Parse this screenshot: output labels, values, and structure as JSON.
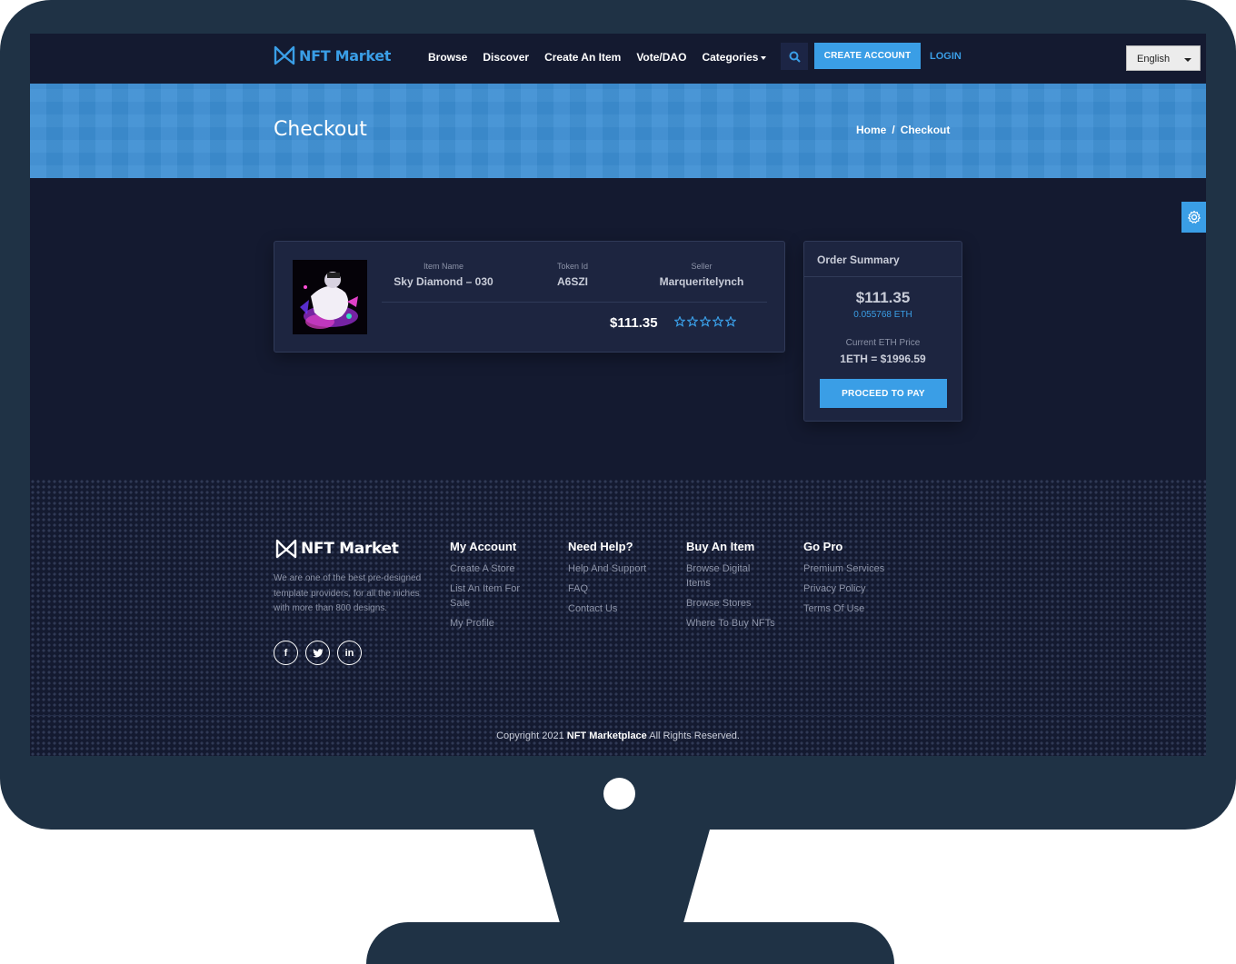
{
  "header": {
    "logo_text": "NFT Market",
    "nav": [
      "Browse",
      "Discover",
      "Create An Item",
      "Vote/DAO",
      "Categories"
    ],
    "create_account": "CREATE ACCOUNT",
    "login": "LOGIN",
    "language": "English"
  },
  "banner": {
    "title": "Checkout",
    "breadcrumb_home": "Home",
    "breadcrumb_sep": "/",
    "breadcrumb_current": "Checkout"
  },
  "item": {
    "name_label": "Item Name",
    "name": "Sky Diamond – 030",
    "token_label": "Token Id",
    "token": "A6SZI",
    "seller_label": "Seller",
    "seller": "Marqueritelynch",
    "price": "$111.35",
    "rating": 5
  },
  "summary": {
    "title": "Order Summary",
    "price": "$111.35",
    "eth": "0.055768 ETH",
    "eth_price_label": "Current ETH Price",
    "eth_rate": "1ETH = $1996.59",
    "pay_button": "PROCEED TO PAY"
  },
  "footer": {
    "logo_text": "NFT Market",
    "about": "We are one of the best pre-designed template providers, for all the niches with more than 800 designs.",
    "socials": [
      "facebook",
      "twitter",
      "linkedin"
    ],
    "columns": [
      {
        "title": "My Account",
        "links": [
          "Create A Store",
          "List An Item For Sale",
          "My Profile"
        ]
      },
      {
        "title": "Need Help?",
        "links": [
          "Help And Support",
          "FAQ",
          "Contact Us"
        ]
      },
      {
        "title": "Buy An Item",
        "links": [
          "Browse Digital Items",
          "Browse Stores",
          "Where To Buy NFTs"
        ]
      },
      {
        "title": "Go Pro",
        "links": [
          "Premium Services",
          "Privacy Policy",
          "Terms Of Use"
        ]
      }
    ],
    "copyright_pre": "Copyright 2021",
    "copyright_brand": "NFT Marketplace",
    "copyright_post": "All Rights Reserved."
  },
  "colors": {
    "accent": "#3a9ee6",
    "background": "#141a30",
    "card": "#1d2540",
    "banner": "#3d8fd3"
  }
}
